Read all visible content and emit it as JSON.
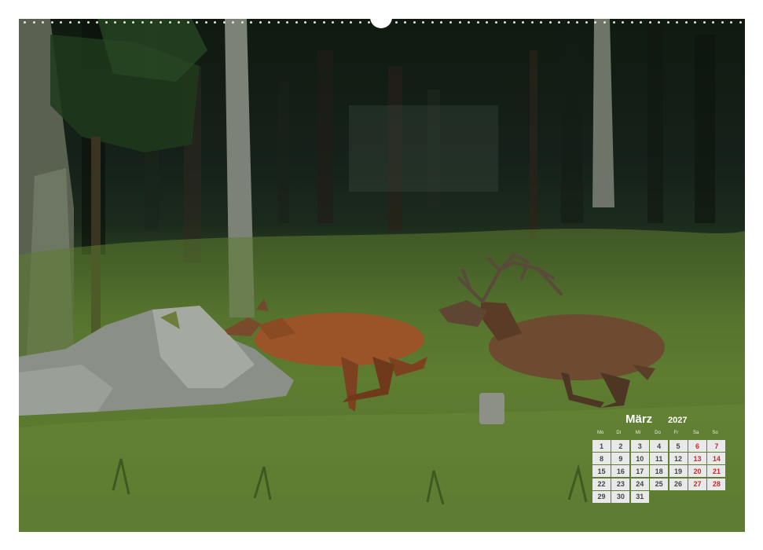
{
  "calendar": {
    "month": "März",
    "year": "2027",
    "weekdays": [
      "Mo",
      "Di",
      "Mi",
      "Do",
      "Fr",
      "Sa",
      "So"
    ],
    "weeks": [
      [
        "1",
        "2",
        "3",
        "4",
        "5",
        "6",
        "7"
      ],
      [
        "8",
        "9",
        "10",
        "11",
        "12",
        "13",
        "14"
      ],
      [
        "15",
        "16",
        "17",
        "18",
        "19",
        "20",
        "21"
      ],
      [
        "22",
        "23",
        "24",
        "25",
        "26",
        "27",
        "28"
      ],
      [
        "29",
        "30",
        "31",
        "",
        "",
        "",
        ""
      ]
    ],
    "weekend_color": "#cc2b2b"
  },
  "photo": {
    "subject": "red-deer-stag-chasing-hind"
  }
}
